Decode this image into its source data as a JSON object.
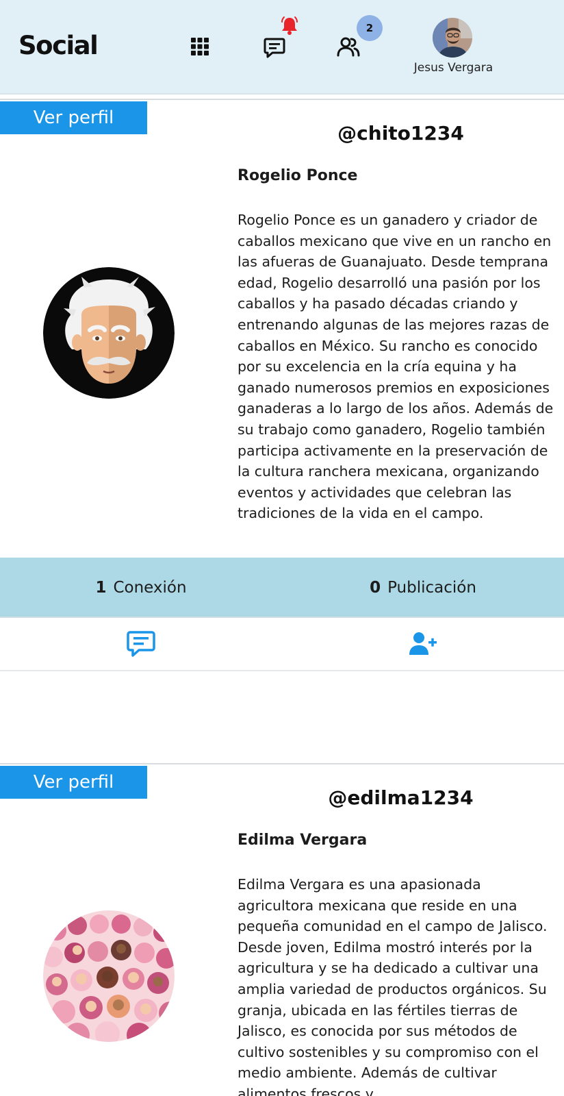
{
  "app": {
    "logo": "Social"
  },
  "header": {
    "icons": [
      "apps-grid-icon",
      "messages-icon",
      "notification-bell-icon",
      "friends-icon"
    ],
    "friends_badge": "2",
    "user_name": "Jesus Vergara"
  },
  "colors": {
    "header_bg": "#e1f0f7",
    "accent_blue": "#1a95e8",
    "stats_bg": "#add8e6",
    "bell_red": "#e8232b",
    "badge_blue": "#8fb2e6"
  },
  "profiles": [
    {
      "view_label": "Ver perfil",
      "handle": "@chito1234",
      "name": "Rogelio Ponce",
      "bio": "Rogelio Ponce es un ganadero y criador de caballos mexicano que vive en un rancho en las afueras de Guanajuato. Desde temprana edad, Rogelio desarrolló una pasión por los caballos y ha pasado décadas criando y entrenando algunas de las mejores razas de caballos en México. Su rancho es conocido por su excelencia en la cría equina y ha ganado numerosos premios en exposiciones ganaderas a lo largo de los años. Además de su trabajo como ganadero, Rogelio también participa activamente en la preservación de la cultura ranchera mexicana, organizando eventos y actividades que celebran las tradiciones de la vida en el campo.",
      "connections_count": "1",
      "connections_label": "Conexión",
      "posts_count": "0",
      "posts_label": "Publicación",
      "action_icons": [
        "message-icon",
        "add-friend-icon"
      ]
    },
    {
      "view_label": "Ver perfil",
      "handle": "@edilma1234",
      "name": "Edilma Vergara",
      "bio": "Edilma Vergara es una apasionada agricultora mexicana que reside en una pequeña comunidad en el campo de Jalisco. Desde joven, Edilma mostró interés por la agricultura y se ha dedicado a cultivar una amplia variedad de productos orgánicos. Su granja, ubicada en las fértiles tierras de Jalisco, es conocida por sus métodos de cultivo sostenibles y su compromiso con el medio ambiente. Además de cultivar alimentos frescos y"
    }
  ]
}
